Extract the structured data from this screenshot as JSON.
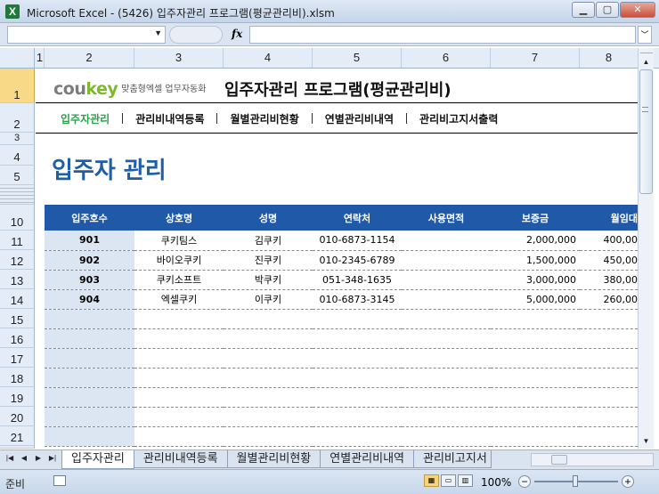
{
  "window": {
    "title": "Microsoft Excel - (5426) 입주자관리 프로그램(평균관리비).xlsm",
    "app_icon": "X"
  },
  "formula_bar": {
    "name_box": "",
    "fx": "fx",
    "content": ""
  },
  "columns": [
    "1",
    "2",
    "3",
    "4",
    "5",
    "6",
    "7",
    "8"
  ],
  "rows": [
    "1",
    "2",
    "3",
    "4",
    "5",
    "10",
    "11",
    "12",
    "13",
    "14",
    "15",
    "16",
    "17",
    "18",
    "19",
    "20",
    "21"
  ],
  "logo": {
    "part1": "cou",
    "part2": "key",
    "tagline": "맞춤형엑셀 업무자동화"
  },
  "app_title": "입주자관리 프로그램(평균관리비)",
  "nav": [
    {
      "label": "입주자관리",
      "active": true
    },
    {
      "label": "관리비내역등록",
      "active": false
    },
    {
      "label": "월별관리비현황",
      "active": false
    },
    {
      "label": "연별관리비내역",
      "active": false
    },
    {
      "label": "관리비고지서출력",
      "active": false
    }
  ],
  "page_title": "입주자 관리",
  "table": {
    "headers": [
      "입주호수",
      "상호명",
      "성명",
      "연락처",
      "사용면적",
      "보증금",
      "월임대"
    ],
    "rows": [
      [
        "901",
        "쿠키팀스",
        "김쿠키",
        "010-6873-1154",
        "",
        "2,000,000",
        "400,00"
      ],
      [
        "902",
        "바이오쿠키",
        "진쿠키",
        "010-2345-6789",
        "",
        "1,500,000",
        "450,00"
      ],
      [
        "903",
        "쿠키소프트",
        "박쿠키",
        "051-348-1635",
        "",
        "3,000,000",
        "380,00"
      ],
      [
        "904",
        "엑셀쿠키",
        "이쿠키",
        "010-6873-3145",
        "",
        "5,000,000",
        "260,00"
      ]
    ],
    "empty_rows": 7
  },
  "sheet_tabs": [
    "입주자관리",
    "관리비내역등록",
    "월별관리비현황",
    "연별관리비내역",
    "관리비고지서"
  ],
  "status": {
    "ready": "준비",
    "zoom": "100%"
  }
}
